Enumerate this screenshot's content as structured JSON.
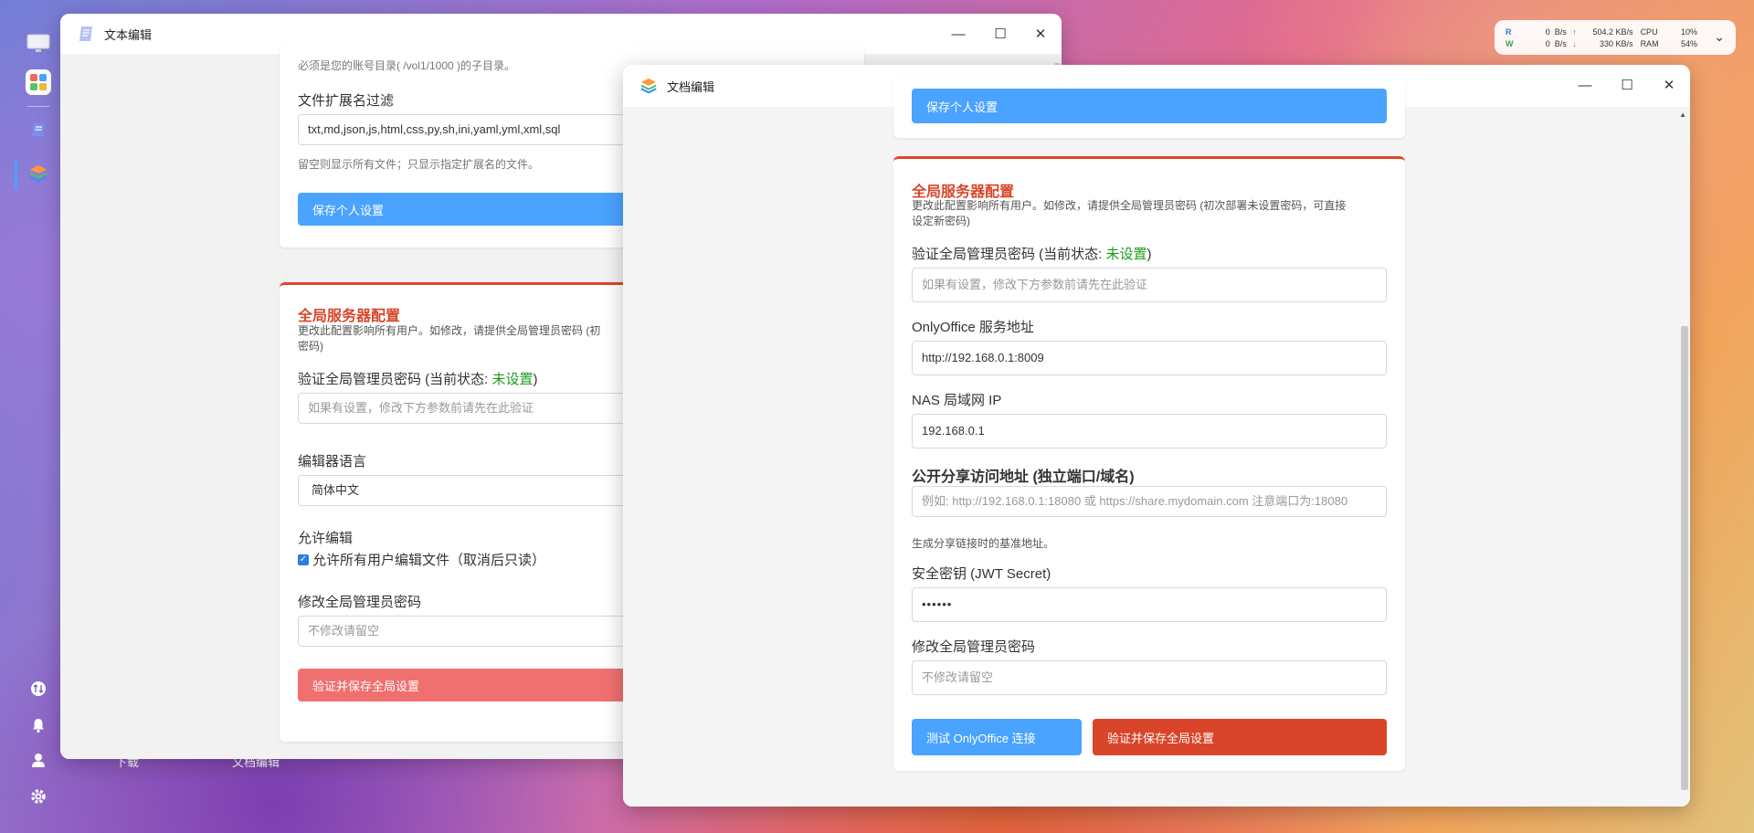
{
  "stats": {
    "r_label": "R",
    "w_label": "W",
    "r_val": "0",
    "w_val": "0",
    "unit": "B/s",
    "up_val": "504.2 KB/s",
    "down_val": "330 KB/s",
    "cpu_label": "CPU",
    "cpu_val": "10%",
    "ram_label": "RAM",
    "ram_val": "54%"
  },
  "dock": {
    "icons": [
      "monitor-icon",
      "app-grid-icon",
      "text-editor-icon",
      "doc-editor-icon"
    ],
    "bottom": [
      "transfer-icon",
      "bell-icon",
      "user-icon",
      "settings-icon"
    ]
  },
  "desktop_labels": {
    "left": "下载",
    "right": "文档编辑"
  },
  "back_window": {
    "title": "文本编辑",
    "top_hint": "必须是您的账号目录( /vol1/1000 )的子目录。",
    "ext_label": "文件扩展名过滤",
    "ext_value": "txt,md,json,js,html,css,py,sh,ini,yaml,yml,xml,sql",
    "ext_hint": "留空则显示所有文件；只显示指定扩展名的文件。",
    "save_personal": "保存个人设置",
    "server_title": "全局服务器配置",
    "server_desc_1": "更改此配置影响所有用户。如修改，请提供全局管理员密码 (初",
    "server_desc_2": "密码)",
    "verify_label": "验证全局管理员密码 (当前状态: ",
    "verify_status": "未设置",
    "verify_close": ")",
    "verify_placeholder": "如果有设置，修改下方参数前请先在此验证",
    "lang_label": "编辑器语言",
    "lang_value": "简体中文",
    "allow_label": "允许编辑",
    "allow_checkbox": "允许所有用户编辑文件（取消后只读）",
    "change_pwd_label": "修改全局管理员密码",
    "change_pwd_placeholder": "不修改请留空",
    "verify_save": "验证并保存全局设置"
  },
  "front_window": {
    "title": "文档编辑",
    "top_button": "保存个人设置",
    "server_title": "全局服务器配置",
    "server_desc_1": "更改此配置影响所有用户。如修改，请提供全局管理员密码 (初次部署未设置密码，可直接",
    "server_desc_2": "设定新密码)",
    "verify_label": "验证全局管理员密码 (当前状态: ",
    "verify_status": "未设置",
    "verify_close": ")",
    "verify_placeholder": "如果有设置，修改下方参数前请先在此验证",
    "onlyoffice_label": "OnlyOffice 服务地址",
    "onlyoffice_value": "http://192.168.0.1:8009",
    "nas_label": "NAS 局域网 IP",
    "nas_value": "192.168.0.1",
    "share_label": "公开分享访问地址 (独立端口/域名)",
    "share_placeholder": "例如: http://192.168.0.1:18080 或 https://share.mydomain.com 注意端口为:18080",
    "share_hint": "生成分享链接时的基准地址。",
    "jwt_label": "安全密钥 (JWT Secret)",
    "jwt_value": "••••••",
    "change_pwd_label": "修改全局管理员密码",
    "change_pwd_placeholder": "不修改请留空",
    "test_button": "测试 OnlyOffice 连接",
    "verify_save": "验证并保存全局设置"
  },
  "colors": {
    "blue": "#4aa3ff",
    "red": "#d9452a",
    "light_red": "#f07070"
  }
}
